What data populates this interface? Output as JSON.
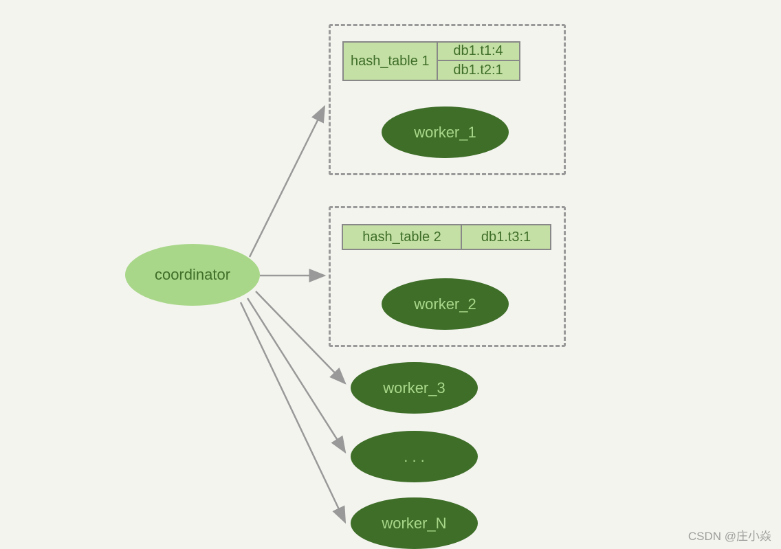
{
  "coordinator": {
    "label": "coordinator"
  },
  "workers": {
    "w1": "worker_1",
    "w2": "worker_2",
    "w3": "worker_3",
    "ellipsis": ". . .",
    "wn": "worker_N"
  },
  "hashTables": {
    "t1": {
      "name": "hash_table 1",
      "entries": {
        "e1": "db1.t1:4",
        "e2": "db1.t2:1"
      }
    },
    "t2": {
      "name": "hash_table 2",
      "entries": {
        "e1": "db1.t3:1"
      }
    }
  },
  "watermark": "CSDN @庄小焱"
}
